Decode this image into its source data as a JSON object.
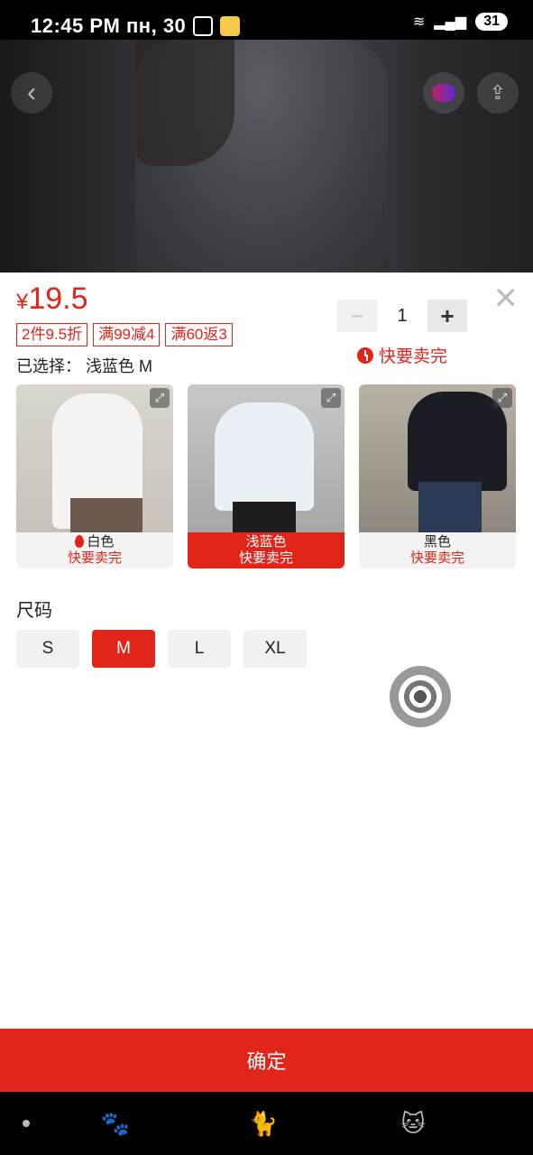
{
  "status_bar": {
    "time": "12:45 PM",
    "date": "пн, 30",
    "battery": "31"
  },
  "header": {
    "back_icon": "chevron-left-icon",
    "ar_icon": "ar-icon",
    "share_icon": "share-icon"
  },
  "product": {
    "currency": "¥",
    "price": "19.5",
    "promos": [
      "2件9.5折",
      "满99减4",
      "满60返3"
    ],
    "selected_label": "已选择：",
    "selected_value": "浅蓝色 M",
    "quantity": "1",
    "hot_label": "快要卖完"
  },
  "colors": [
    {
      "name": "白色",
      "status": "快要卖完",
      "selected": false
    },
    {
      "name": "浅蓝色",
      "status": "快要卖完",
      "selected": true
    },
    {
      "name": "黑色",
      "status": "快要卖完",
      "selected": false
    }
  ],
  "size": {
    "title": "尺码",
    "options": [
      "S",
      "M",
      "L",
      "XL"
    ],
    "selected": "M"
  },
  "confirm_label": "确定",
  "accent_color": "#e1251b"
}
